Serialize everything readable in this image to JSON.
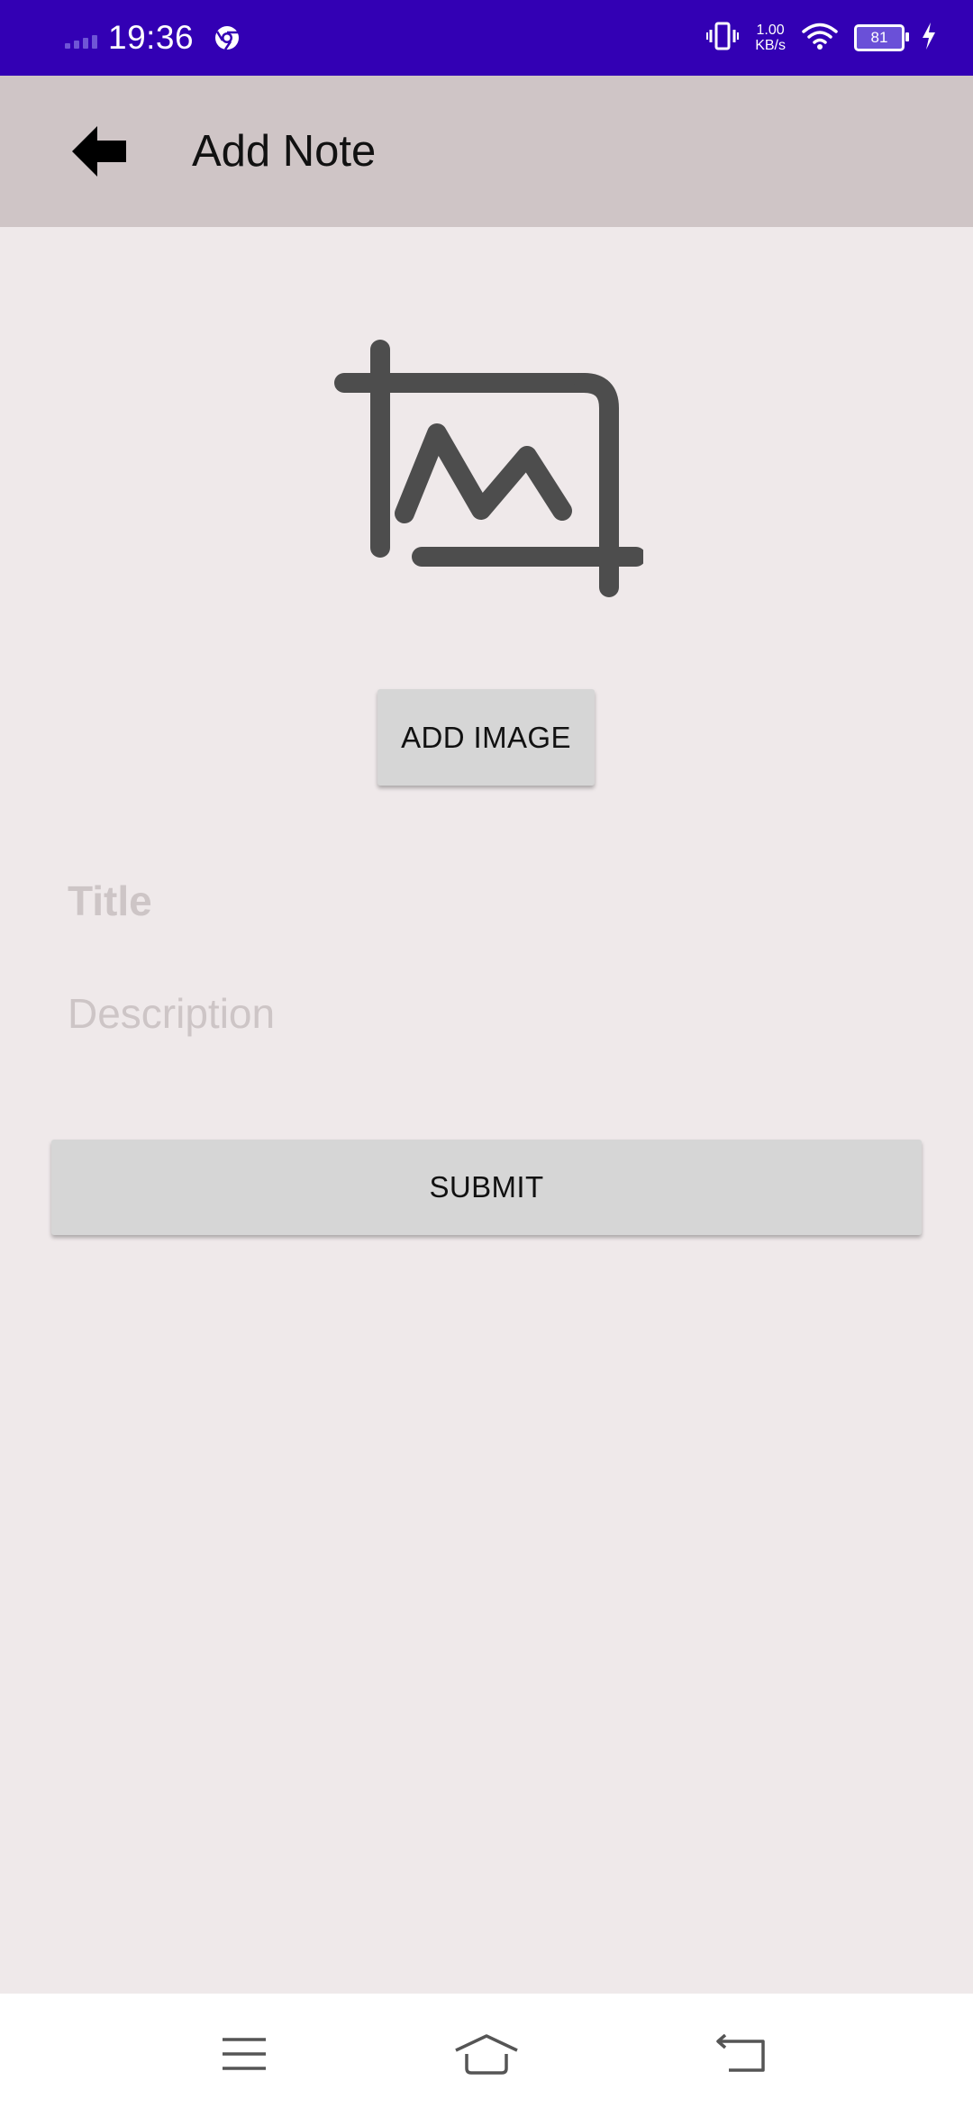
{
  "status_bar": {
    "time": "19:36",
    "net_speed_value": "1.00",
    "net_speed_unit": "KB/s",
    "battery_level": "81",
    "background_color": "#3300b4",
    "icons": [
      "signal-icon",
      "chrome-icon",
      "vibrate-icon",
      "wifi-icon",
      "battery-icon",
      "charging-icon"
    ]
  },
  "toolbar": {
    "title": "Add Note",
    "background_color": "#cfc5c6",
    "back_icon": "back-arrow-icon"
  },
  "main": {
    "image_placeholder_icon": "crop-image-icon",
    "add_image_label": "ADD IMAGE",
    "title_field": {
      "placeholder": "Title",
      "value": ""
    },
    "description_field": {
      "placeholder": "Description",
      "value": ""
    },
    "submit_label": "SUBMIT",
    "background_color": "#efe9ea"
  },
  "nav_bar": {
    "icons": [
      "menu-icon",
      "home-icon",
      "back-icon"
    ]
  }
}
